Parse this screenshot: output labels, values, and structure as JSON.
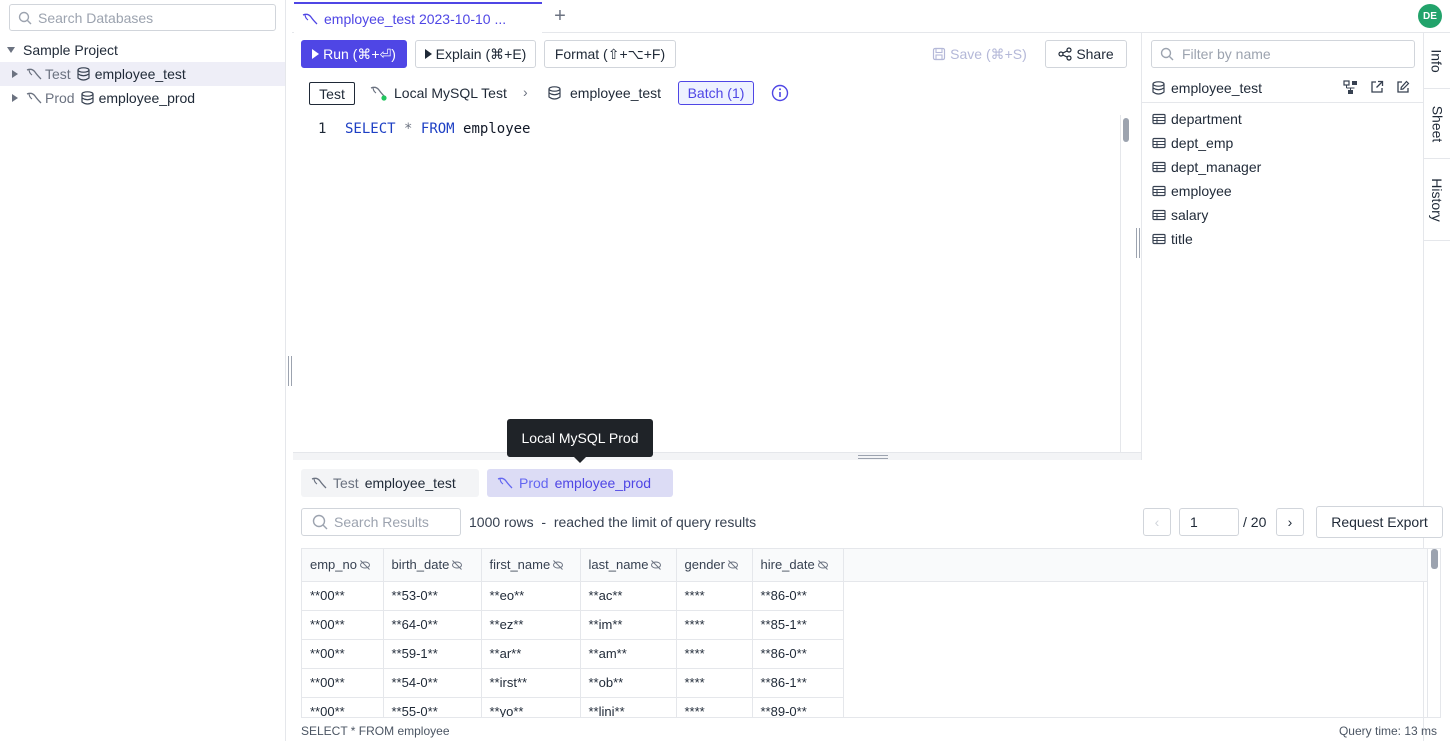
{
  "sidebar": {
    "search_placeholder": "Search Databases",
    "project": "Sample Project",
    "items": [
      {
        "env": "Test",
        "db": "employee_test"
      },
      {
        "env": "Prod",
        "db": "employee_prod"
      }
    ]
  },
  "tabs": {
    "active_label": "employee_test 2023-10-10 ...",
    "add": "+"
  },
  "avatar": "DE",
  "toolbar": {
    "run": "Run (⌘+⏎)",
    "explain": "Explain (⌘+E)",
    "format": "Format (⇧+⌥+F)",
    "save": "Save (⌘+S)",
    "share": "Share"
  },
  "context": {
    "env": "Test",
    "instance": "Local MySQL Test",
    "database": "employee_test",
    "batch": "Batch (1)"
  },
  "editor": {
    "line_number": "1",
    "kw_select": "SELECT",
    "star": "*",
    "kw_from": "FROM",
    "table": "employee"
  },
  "right_panel": {
    "filter_placeholder": "Filter by name",
    "database": "employee_test",
    "tables": [
      "department",
      "dept_emp",
      "dept_manager",
      "employee",
      "salary",
      "title"
    ]
  },
  "vtabs": [
    "Info",
    "Sheet",
    "History"
  ],
  "tooltip": "Local MySQL Prod",
  "result_tabs": [
    {
      "env": "Test",
      "db": "employee_test"
    },
    {
      "env": "Prod",
      "db": "employee_prod"
    }
  ],
  "results": {
    "search_placeholder": "Search Results",
    "rows_info": "1000 rows  -  reached the limit of query results",
    "page": "1",
    "page_total": "/ 20",
    "export": "Request Export",
    "prev": "‹",
    "next": "›",
    "columns": [
      "emp_no",
      "birth_date",
      "first_name",
      "last_name",
      "gender",
      "hire_date"
    ],
    "rows": [
      [
        "**00**",
        "**53-0**",
        "**eo**",
        "**ac**",
        "****",
        "**86-0**"
      ],
      [
        "**00**",
        "**64-0**",
        "**ez**",
        "**im**",
        "****",
        "**85-1**"
      ],
      [
        "**00**",
        "**59-1**",
        "**ar**",
        "**am**",
        "****",
        "**86-0**"
      ],
      [
        "**00**",
        "**54-0**",
        "**irst**",
        "**ob**",
        "****",
        "**86-1**"
      ],
      [
        "**00**",
        "**55-0**",
        "**yo**",
        "**lini**",
        "****",
        "**89-0**"
      ]
    ]
  },
  "status": {
    "query": "SELECT * FROM employee",
    "time": "Query time: 13 ms"
  },
  "colors": {
    "accent": "#4f46e5",
    "avatar": "#22a36b",
    "selected_row": "#eeeef7"
  }
}
